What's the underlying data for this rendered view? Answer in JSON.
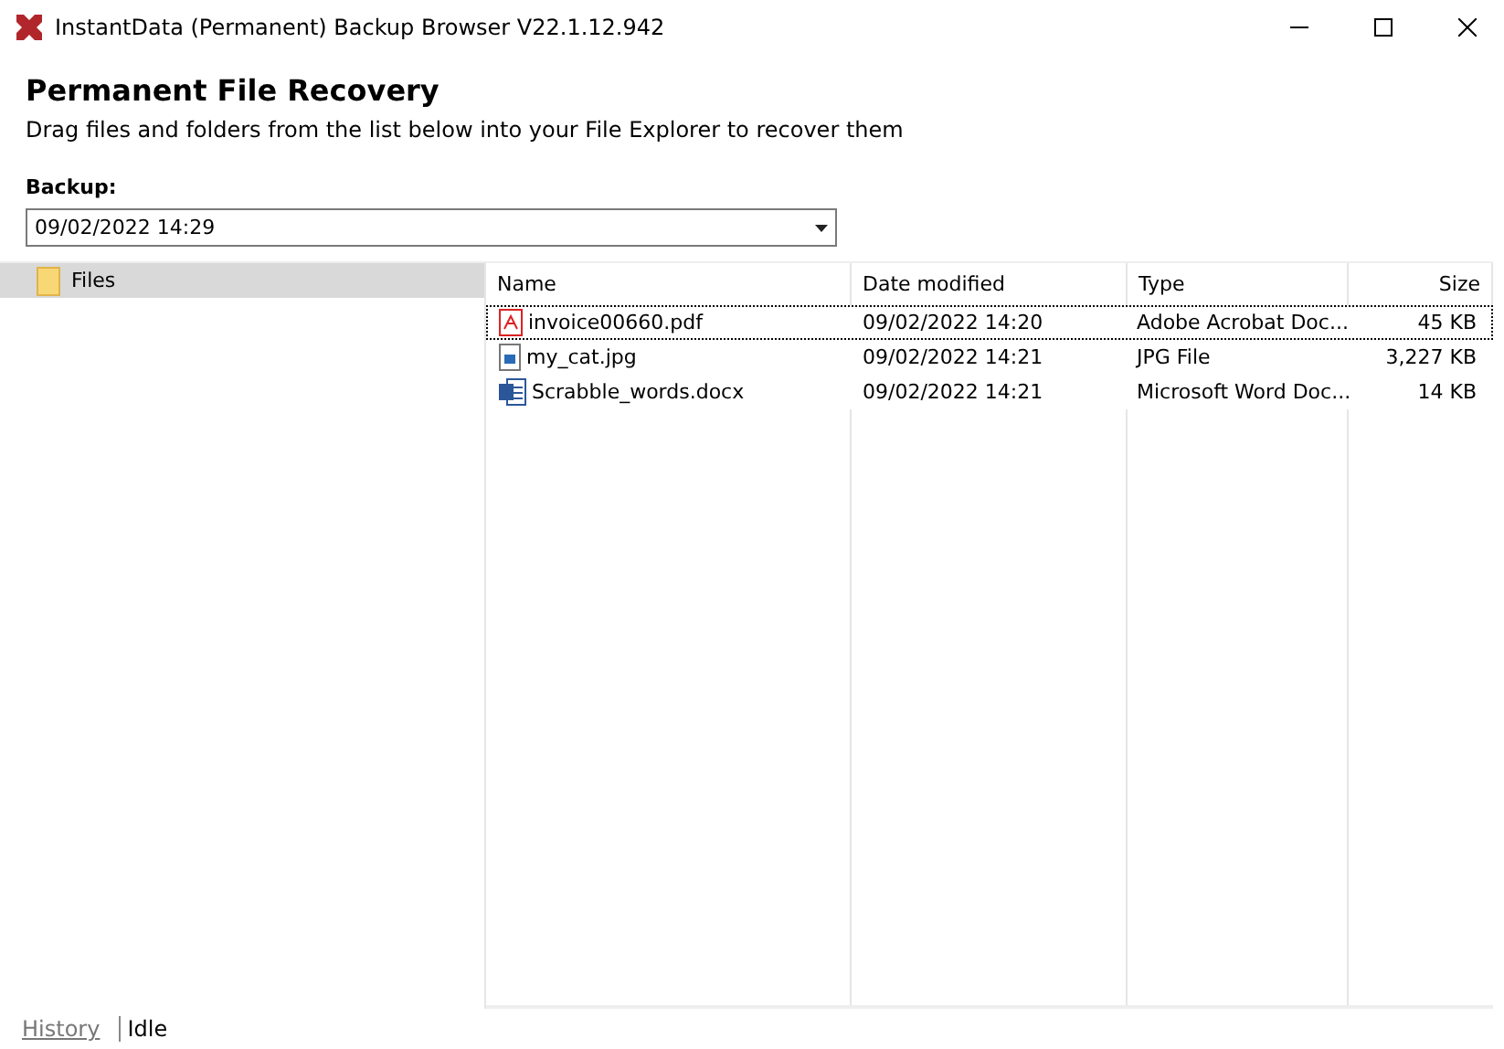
{
  "window": {
    "title": "InstantData (Permanent) Backup Browser V22.1.12.942"
  },
  "heading": "Permanent File Recovery",
  "subtitle": "Drag files and folders from the list below into your File Explorer to recover them",
  "backup": {
    "label": "Backup:",
    "value": "09/02/2022 14:29"
  },
  "tree": {
    "items": [
      {
        "label": "Files",
        "selected": true
      }
    ]
  },
  "table": {
    "columns": [
      "Name",
      "Date modified",
      "Type",
      "Size"
    ],
    "rows": [
      {
        "kind": "pdf",
        "name": "invoice00660.pdf",
        "date": "09/02/2022 14:20",
        "type": "Adobe Acrobat Doc...",
        "size": "45 KB",
        "selected": true
      },
      {
        "kind": "image",
        "name": "my_cat.jpg",
        "date": "09/02/2022 14:21",
        "type": "JPG File",
        "size": "3,227 KB",
        "selected": false
      },
      {
        "kind": "word",
        "name": "Scrabble_words.docx",
        "date": "09/02/2022 14:21",
        "type": "Microsoft Word Doc...",
        "size": "14 KB",
        "selected": false
      }
    ]
  },
  "status_bar": {
    "link": "History",
    "status": "Idle"
  }
}
